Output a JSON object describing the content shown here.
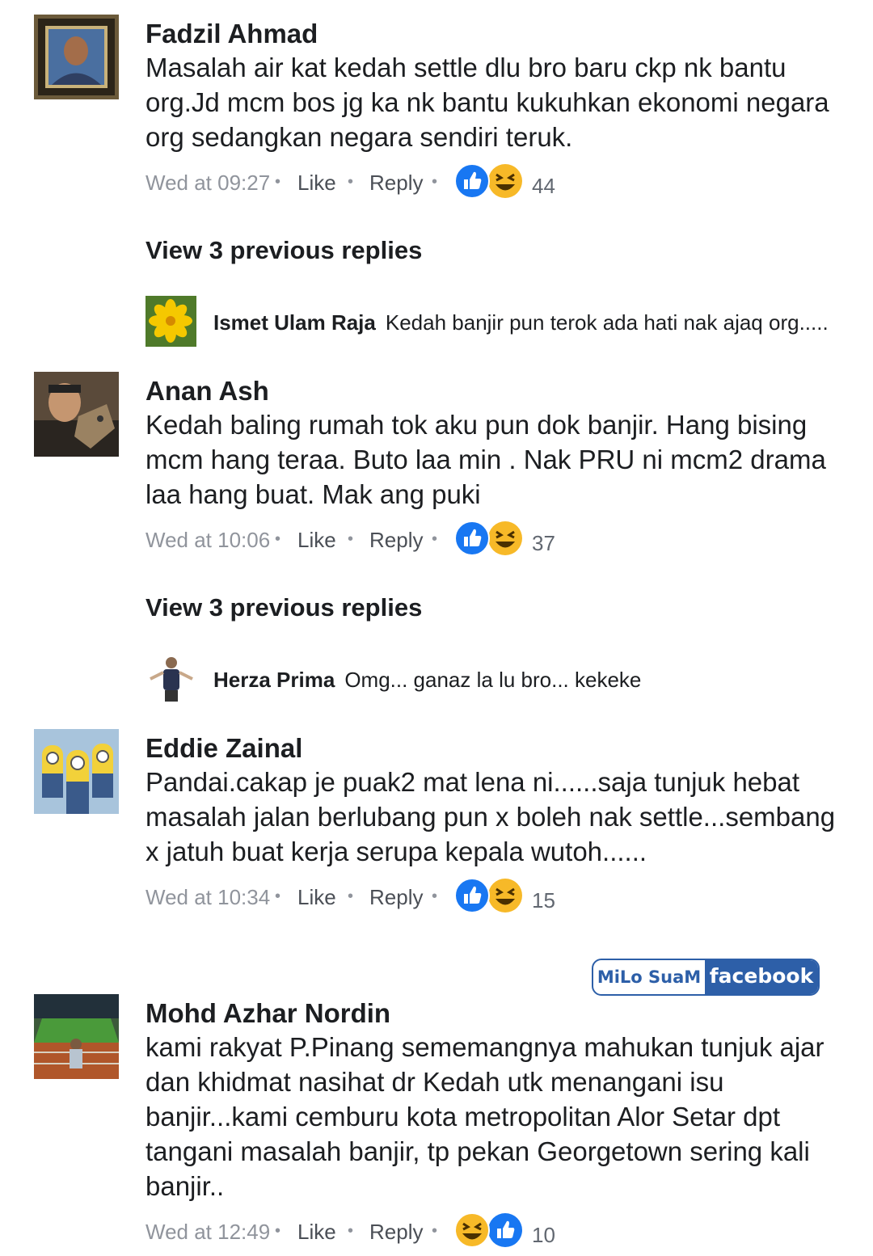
{
  "comments": [
    {
      "author": "Fadzil Ahmad",
      "text": "Masalah air kat kedah settle dlu bro baru ckp nk bantu org.Jd mcm bos jg ka nk bantu kukuhkan ekonomi negara org sedangkan negara sendiri teruk.",
      "time": "Wed at 09:27",
      "like_label": "Like",
      "reply_label": "Reply",
      "reactions": [
        "like-icon",
        "haha-icon"
      ],
      "reaction_count": "44",
      "view_previous": "View 3 previous replies",
      "latest_reply": {
        "author": "Ismet Ulam Raja",
        "text": "Kedah banjir pun terok ada hati nak ajaq org....."
      }
    },
    {
      "author": "Anan Ash",
      "text": "Kedah baling rumah tok aku pun dok banjir. Hang bising mcm hang teraa. Buto laa min . Nak PRU ni mcm2 drama laa hang buat. Mak ang puki",
      "time": "Wed at 10:06",
      "like_label": "Like",
      "reply_label": "Reply",
      "reactions": [
        "like-icon",
        "haha-icon"
      ],
      "reaction_count": "37",
      "view_previous": "View 3 previous replies",
      "latest_reply": {
        "author": "Herza Prima",
        "text": "Omg... ganaz la lu bro... kekeke"
      }
    },
    {
      "author": "Eddie Zainal",
      "text": "Pandai.cakap je puak2 mat lena ni......saja tunjuk hebat masalah jalan berlubang pun x boleh nak settle...sembang x jatuh buat kerja serupa kepala wutoh......",
      "time": "Wed at 10:34",
      "like_label": "Like",
      "reply_label": "Reply",
      "reactions": [
        "like-icon",
        "haha-icon"
      ],
      "reaction_count": "15"
    },
    {
      "author": "Mohd Azhar Nordin",
      "text": "kami rakyat P.Pinang sememangnya mahukan tunjuk ajar dan khidmat nasihat dr Kedah utk menangani isu banjir...kami cemburu kota metropolitan Alor Setar dpt tangani masalah banjir, tp pekan Georgetown sering kali banjir..",
      "time": "Wed at 12:49",
      "like_label": "Like",
      "reply_label": "Reply",
      "reactions": [
        "haha-icon",
        "like-icon"
      ],
      "reaction_count": "10"
    }
  ],
  "watermark": {
    "left": "MiLo SuaM",
    "right": "facebook"
  },
  "colors": {
    "like_blue": "#1877f2",
    "haha_yellow": "#f7b928",
    "badge_blue": "#2d5fa8"
  }
}
